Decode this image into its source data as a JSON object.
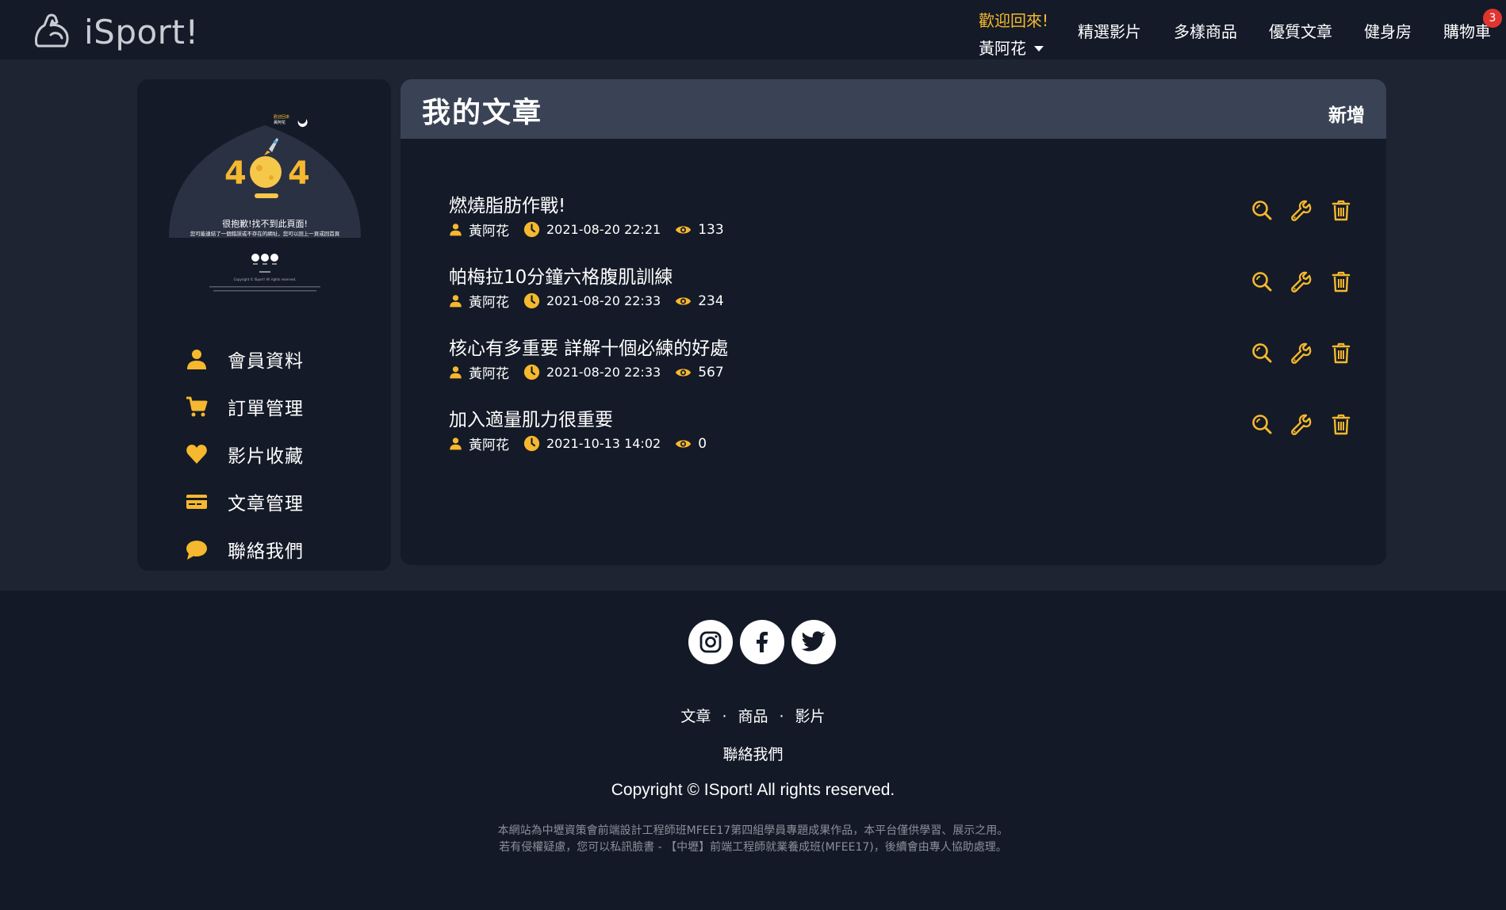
{
  "brand": {
    "name": "iSport!",
    "logo_icon": "flexed-arm-icon"
  },
  "header": {
    "welcome": "歡迎回來!",
    "user": "黃阿花",
    "nav": [
      "精選影片",
      "多樣商品",
      "優質文章",
      "健身房",
      "購物車"
    ],
    "cart_count": "3"
  },
  "sidebar": {
    "thumbnail": {
      "top_small_1": "歡迎回來",
      "top_small_2": "黃阿花",
      "big": "4  4",
      "message": "很抱歉!找不到此頁面!",
      "sub_message": "您可能連結了一個錯誤或不存在的網址，您可以回上一頁或回首頁",
      "copyright": "Copyright © ISport! All rights reserved."
    },
    "items": [
      {
        "label": "會員資料",
        "icon": "user-icon"
      },
      {
        "label": "訂單管理",
        "icon": "cart-icon"
      },
      {
        "label": "影片收藏",
        "icon": "heart-icon"
      },
      {
        "label": "文章管理",
        "icon": "card-icon"
      },
      {
        "label": "聯絡我們",
        "icon": "chat-icon"
      }
    ]
  },
  "main": {
    "title": "我的文章",
    "add_label": "新增",
    "articles": [
      {
        "title": "燃燒脂肪作戰!",
        "author": "黃阿花",
        "date": "2021-08-20 22:21",
        "views": "133"
      },
      {
        "title": "帕梅拉10分鐘六格腹肌訓練",
        "author": "黃阿花",
        "date": "2021-08-20 22:33",
        "views": "234"
      },
      {
        "title": "核心有多重要 詳解十個必練的好處",
        "author": "黃阿花",
        "date": "2021-08-20 22:33",
        "views": "567"
      },
      {
        "title": "加入適量肌力很重要",
        "author": "黃阿花",
        "date": "2021-10-13 14:02",
        "views": "0"
      }
    ]
  },
  "footer": {
    "links": [
      "文章",
      "商品",
      "影片"
    ],
    "separator": "·",
    "contact": "聯絡我們",
    "copyright": "Copyright © ISport! All rights reserved.",
    "note_line1": "本網站為中壢資策會前端設計工程師班MFEE17第四組學員專題成果作品，本平台僅供學習、展示之用。",
    "note_line2": "若有侵權疑慮，您可以私訊臉書 - 【中壢】前端工程師就業養成班(MFEE17)，後續會由專人協助處理。"
  },
  "colors": {
    "accent": "#f5b82e",
    "bg": "#1e2432",
    "panel": "#141a27",
    "panel_head": "#3a4355",
    "badge": "#e0352f"
  }
}
